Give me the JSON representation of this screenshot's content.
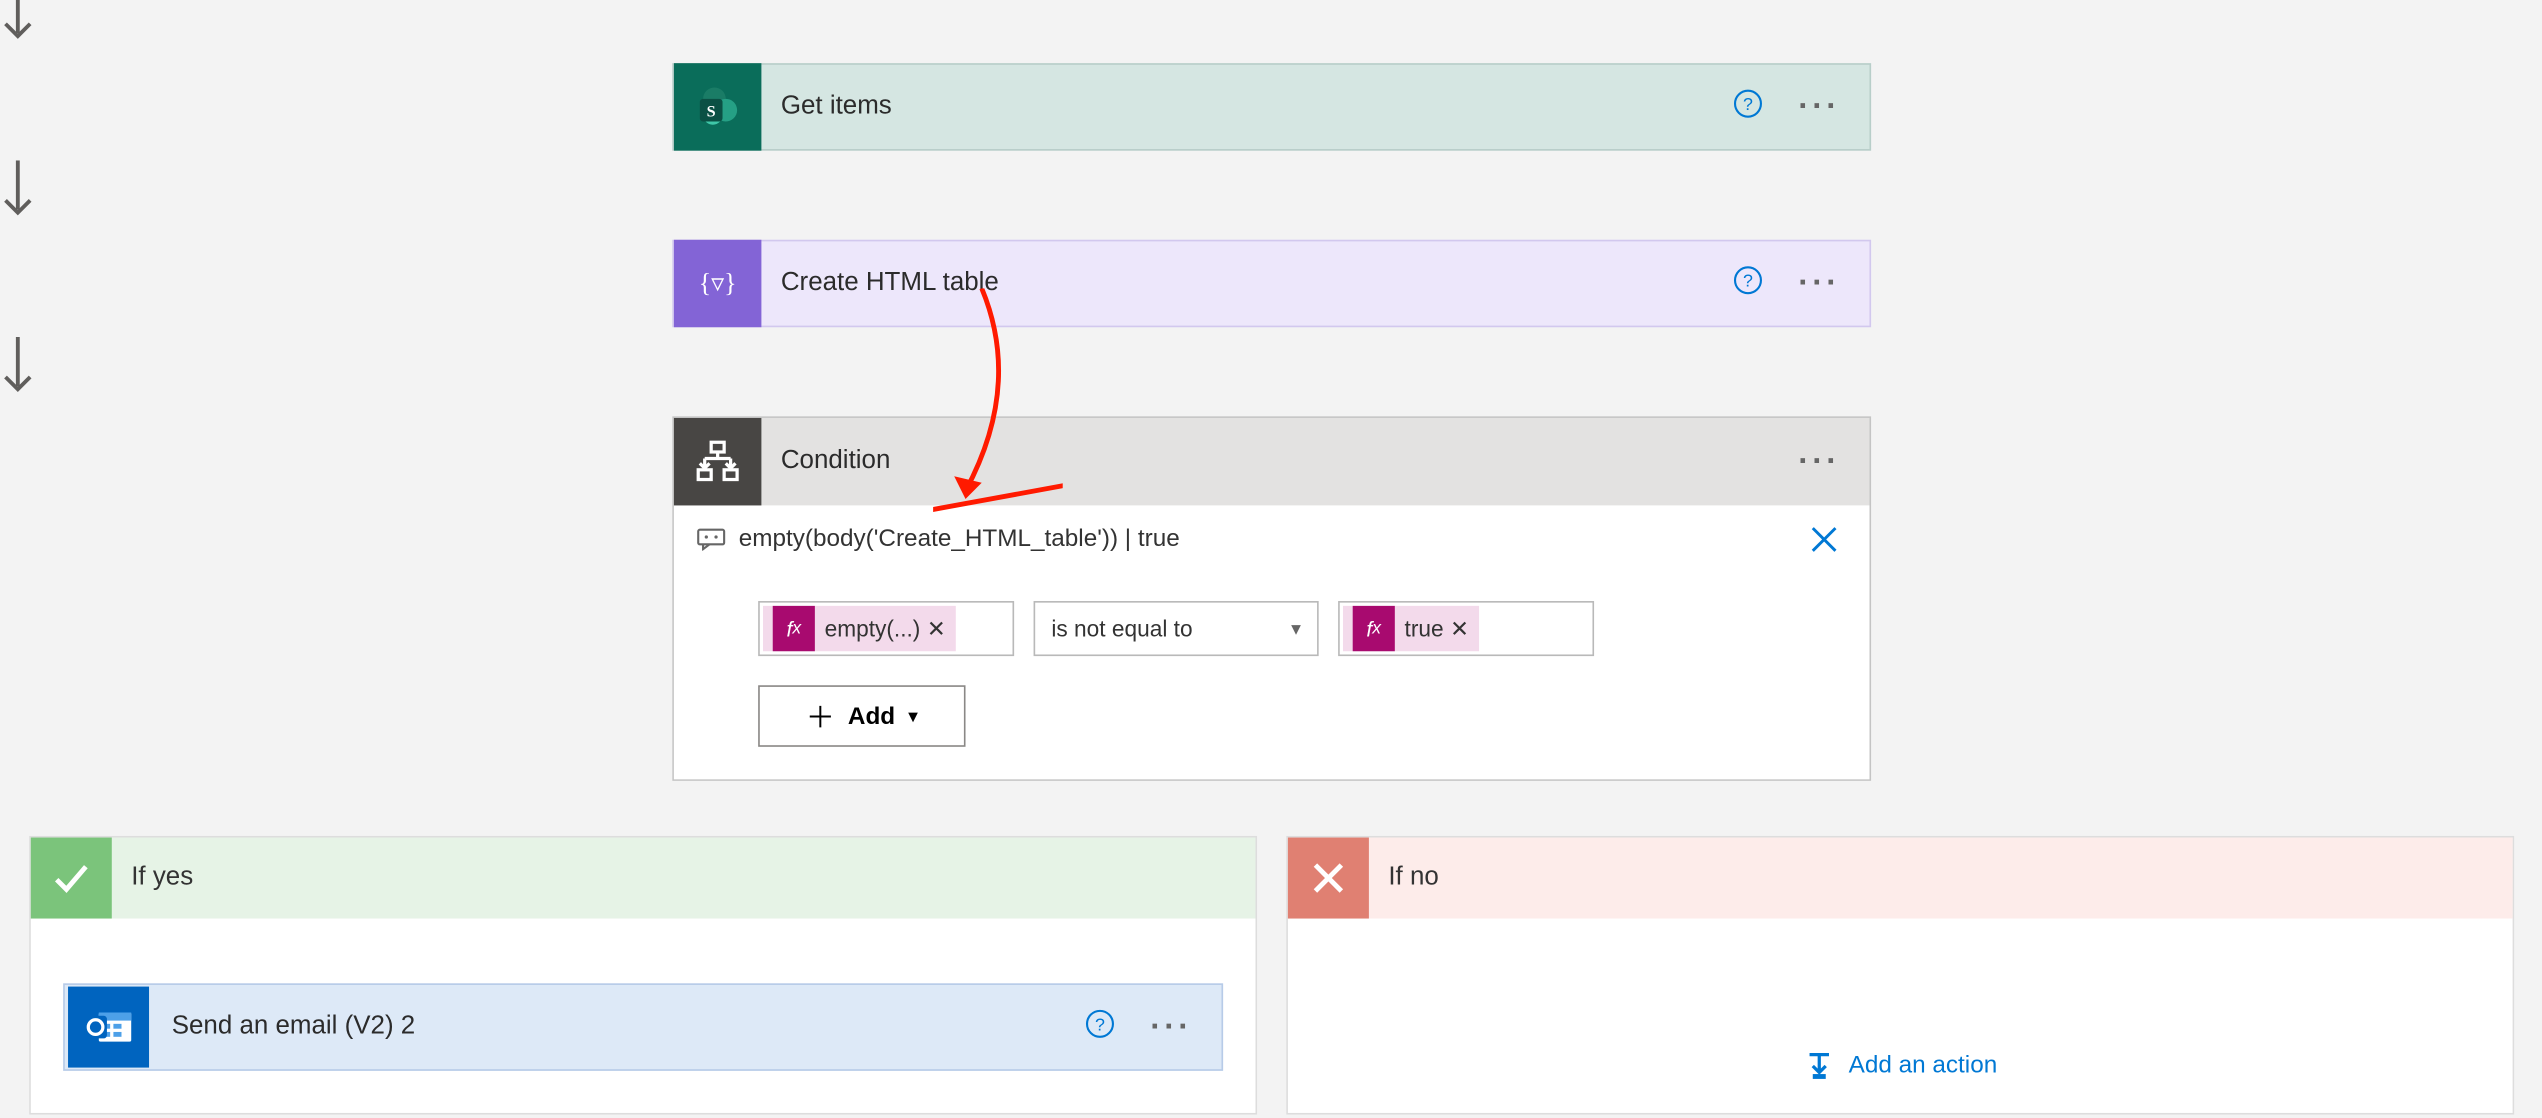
{
  "actions": {
    "get_items": {
      "title": "Get items"
    },
    "create_html": {
      "title": "Create HTML table"
    },
    "condition": {
      "title": "Condition",
      "expression_display": "empty(body('Create_HTML_table')) | true",
      "left_token": "empty(...)",
      "operator": "is not equal to",
      "right_token": "true",
      "add_label": "Add"
    },
    "send_email": {
      "title": "Send an email (V2) 2"
    }
  },
  "branches": {
    "yes_label": "If yes",
    "no_label": "If no",
    "add_action_label": "Add an action"
  }
}
